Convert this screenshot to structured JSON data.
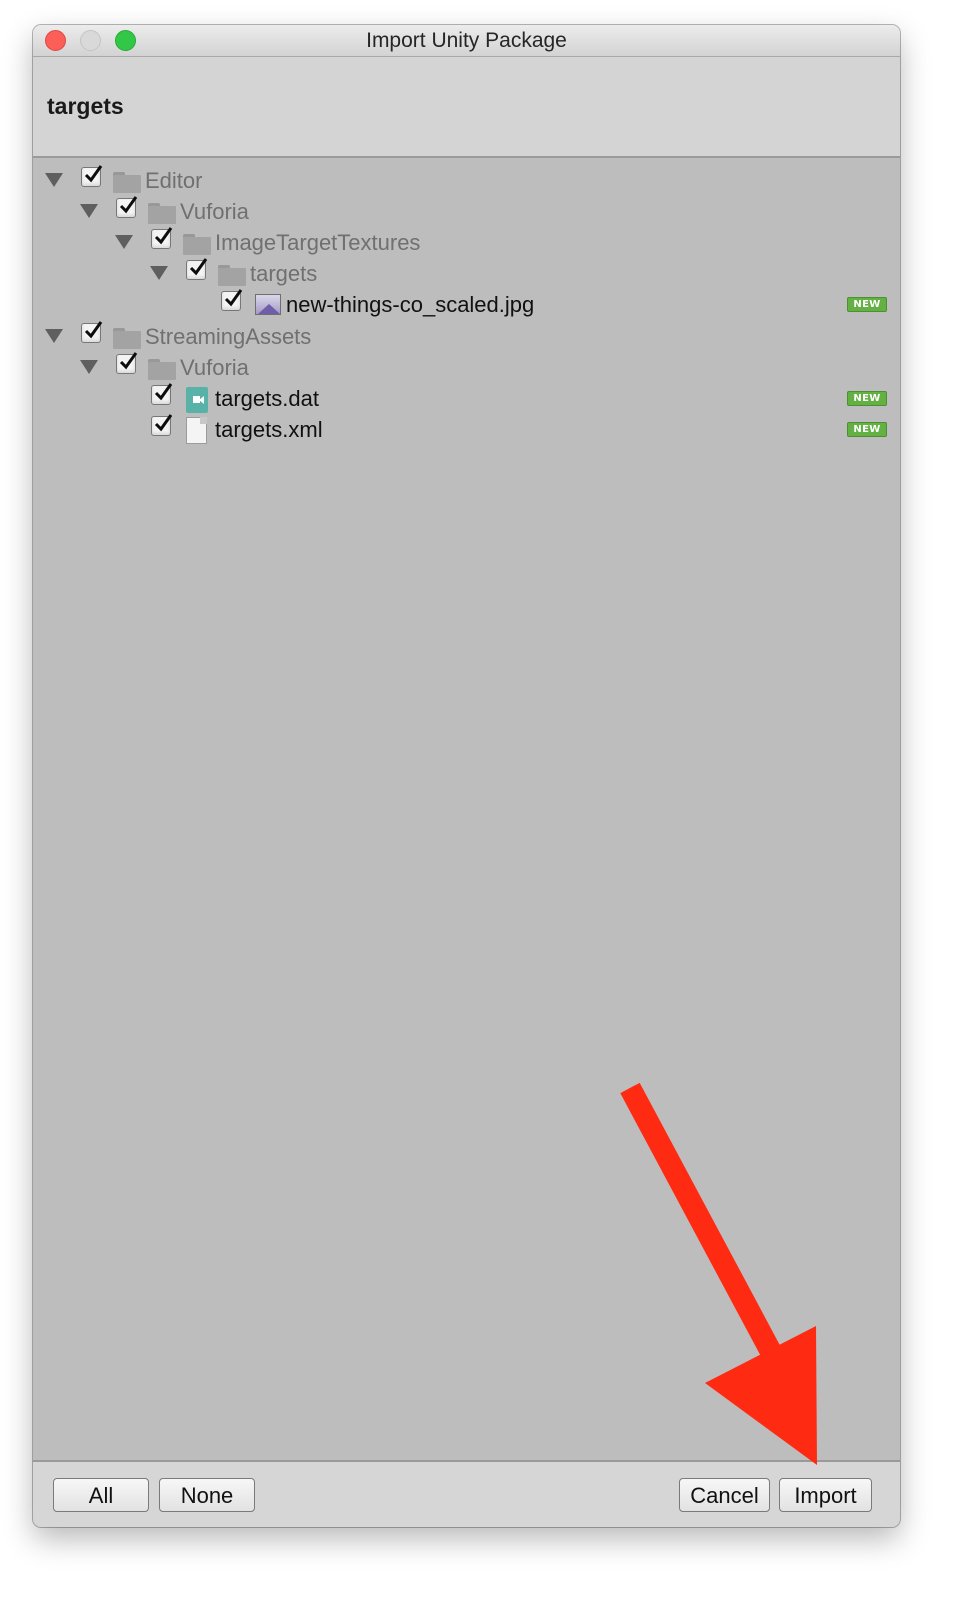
{
  "window": {
    "title": "Import Unity Package",
    "package_name": "targets"
  },
  "tree": [
    {
      "label": "Editor",
      "type": "folder",
      "checked": true,
      "expanded": true,
      "new_badge": ""
    },
    {
      "label": "Vuforia",
      "type": "folder",
      "checked": true,
      "expanded": true,
      "new_badge": ""
    },
    {
      "label": "ImageTargetTextures",
      "type": "folder",
      "checked": true,
      "expanded": true,
      "new_badge": ""
    },
    {
      "label": "targets",
      "type": "folder",
      "checked": true,
      "expanded": true,
      "new_badge": ""
    },
    {
      "label": "new-things-co_scaled.jpg",
      "type": "image-file",
      "checked": true,
      "new_badge": "NEW"
    },
    {
      "label": "StreamingAssets",
      "type": "folder",
      "checked": true,
      "expanded": true,
      "new_badge": ""
    },
    {
      "label": "Vuforia",
      "type": "folder",
      "checked": true,
      "expanded": true,
      "new_badge": ""
    },
    {
      "label": "targets.dat",
      "type": "dat-file",
      "checked": true,
      "new_badge": "NEW"
    },
    {
      "label": "targets.xml",
      "type": "xml-file",
      "checked": true,
      "new_badge": "NEW"
    }
  ],
  "footer": {
    "all_label": "All",
    "none_label": "None",
    "cancel_label": "Cancel",
    "import_label": "Import"
  },
  "icons": {
    "close": "close-icon",
    "minimize": "minimize-icon",
    "maximize": "maximize-icon",
    "folder": "folder-icon",
    "expand": "expand-triangle-icon",
    "checkbox": "checkmark-icon",
    "image_file": "image-file-icon",
    "dat_file": "dat-file-icon",
    "xml_file": "document-icon",
    "annotation": "red-arrow-icon"
  },
  "colors": {
    "close": "#fc5f57",
    "maximize": "#33c748",
    "new_badge": "#63b043",
    "annotation_arrow": "#ff2a12"
  }
}
